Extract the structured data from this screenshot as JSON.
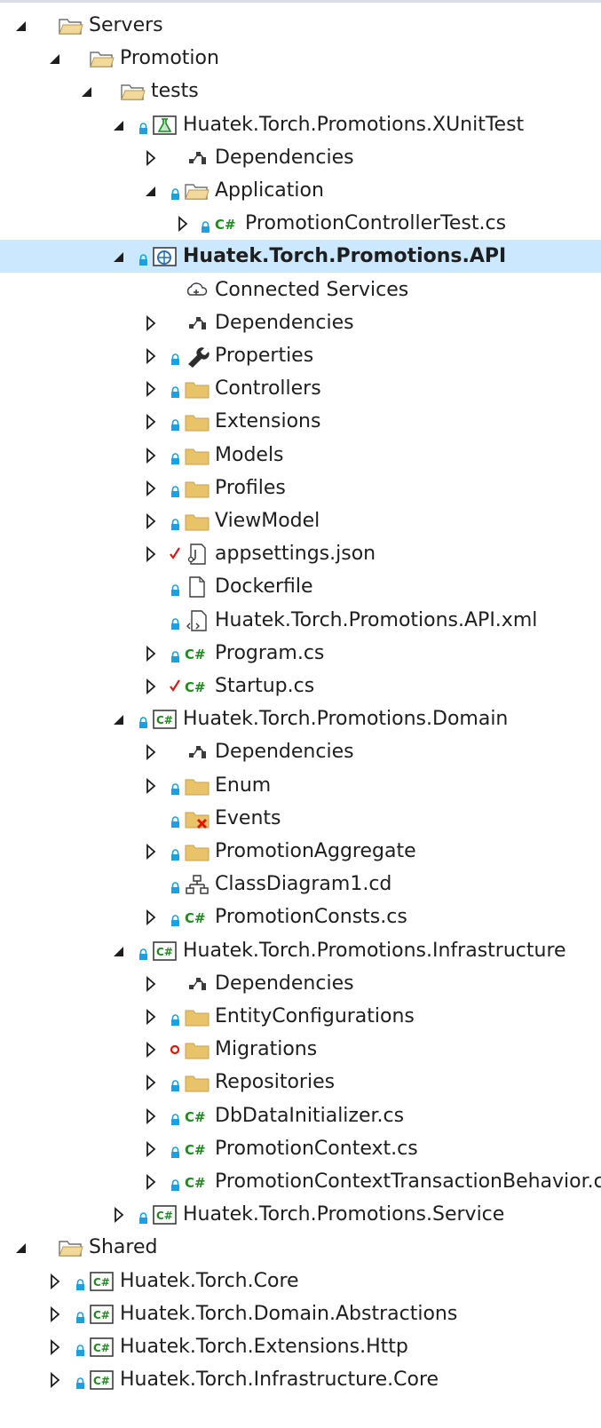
{
  "colors": {
    "folder": "#e8c36a",
    "folder_open": "#f2d99a",
    "selection": "#cce8ff",
    "lock": "#1ba1e2",
    "check": "#d11a1a",
    "csharp_green": "#1e8b1e",
    "csproj_blue": "#2a6fb0",
    "error_red": "#e51400"
  },
  "tree": [
    {
      "label": "Servers",
      "level": 0,
      "caret": "expanded",
      "icon": "folder-open-icon",
      "lock": false
    },
    {
      "label": "Promotion",
      "level": 1,
      "caret": "expanded",
      "icon": "folder-open-icon",
      "lock": false
    },
    {
      "label": "tests",
      "level": 2,
      "caret": "expanded",
      "icon": "folder-open-icon",
      "lock": false
    },
    {
      "label": "Huatek.Torch.Promotions.XUnitTest",
      "level": 3,
      "caret": "expanded",
      "icon": "test-project-icon",
      "lock": true
    },
    {
      "label": "Dependencies",
      "level": 4,
      "caret": "collapsed",
      "icon": "dependencies-icon",
      "lock": false
    },
    {
      "label": "Application",
      "level": 4,
      "caret": "expanded",
      "icon": "folder-open-icon",
      "lock": true
    },
    {
      "label": "PromotionControllerTest.cs",
      "level": 5,
      "caret": "collapsed",
      "icon": "csharp-file-icon",
      "lock": true
    },
    {
      "label": "Huatek.Torch.Promotions.API",
      "level": 3,
      "caret": "expanded",
      "icon": "web-project-icon",
      "lock": true,
      "selected": true
    },
    {
      "label": "Connected Services",
      "level": 4,
      "caret": "none",
      "icon": "connected-services-icon",
      "lock": false
    },
    {
      "label": "Dependencies",
      "level": 4,
      "caret": "collapsed",
      "icon": "dependencies-icon",
      "lock": false
    },
    {
      "label": "Properties",
      "level": 4,
      "caret": "collapsed",
      "icon": "wrench-icon",
      "lock": true
    },
    {
      "label": "Controllers",
      "level": 4,
      "caret": "collapsed",
      "icon": "folder-icon",
      "lock": true
    },
    {
      "label": "Extensions",
      "level": 4,
      "caret": "collapsed",
      "icon": "folder-icon",
      "lock": true
    },
    {
      "label": "Models",
      "level": 4,
      "caret": "collapsed",
      "icon": "folder-icon",
      "lock": true
    },
    {
      "label": "Profiles",
      "level": 4,
      "caret": "collapsed",
      "icon": "folder-icon",
      "lock": true
    },
    {
      "label": "ViewModel",
      "level": 4,
      "caret": "collapsed",
      "icon": "folder-icon",
      "lock": true
    },
    {
      "label": "appsettings.json",
      "level": 4,
      "caret": "collapsed",
      "icon": "json-file-icon",
      "lock": false,
      "status": "check"
    },
    {
      "label": "Dockerfile",
      "level": 4,
      "caret": "none",
      "icon": "file-icon",
      "lock": true
    },
    {
      "label": "Huatek.Torch.Promotions.API.xml",
      "level": 4,
      "caret": "none",
      "icon": "xml-file-icon",
      "lock": true
    },
    {
      "label": "Program.cs",
      "level": 4,
      "caret": "collapsed",
      "icon": "csharp-file-icon",
      "lock": true
    },
    {
      "label": "Startup.cs",
      "level": 4,
      "caret": "collapsed",
      "icon": "csharp-file-icon",
      "lock": false,
      "status": "check"
    },
    {
      "label": "Huatek.Torch.Promotions.Domain",
      "level": 3,
      "caret": "expanded",
      "icon": "csharp-project-icon",
      "lock": true
    },
    {
      "label": "Dependencies",
      "level": 4,
      "caret": "collapsed",
      "icon": "dependencies-icon",
      "lock": false
    },
    {
      "label": "Enum",
      "level": 4,
      "caret": "collapsed",
      "icon": "folder-icon",
      "lock": true
    },
    {
      "label": "Events",
      "level": 4,
      "caret": "none",
      "icon": "folder-error-icon",
      "lock": true
    },
    {
      "label": "PromotionAggregate",
      "level": 4,
      "caret": "collapsed",
      "icon": "folder-icon",
      "lock": true
    },
    {
      "label": "ClassDiagram1.cd",
      "level": 4,
      "caret": "none",
      "icon": "class-diagram-icon",
      "lock": true
    },
    {
      "label": "PromotionConsts.cs",
      "level": 4,
      "caret": "collapsed",
      "icon": "csharp-file-icon",
      "lock": true
    },
    {
      "label": "Huatek.Torch.Promotions.Infrastructure",
      "level": 3,
      "caret": "expanded",
      "icon": "csharp-project-icon",
      "lock": true
    },
    {
      "label": "Dependencies",
      "level": 4,
      "caret": "collapsed",
      "icon": "dependencies-icon",
      "lock": false
    },
    {
      "label": "EntityConfigurations",
      "level": 4,
      "caret": "collapsed",
      "icon": "folder-icon",
      "lock": true
    },
    {
      "label": "Migrations",
      "level": 4,
      "caret": "collapsed",
      "icon": "folder-icon",
      "lock": false,
      "status": "pending"
    },
    {
      "label": "Repositories",
      "level": 4,
      "caret": "collapsed",
      "icon": "folder-icon",
      "lock": true
    },
    {
      "label": "DbDataInitializer.cs",
      "level": 4,
      "caret": "collapsed",
      "icon": "csharp-file-icon",
      "lock": true
    },
    {
      "label": "PromotionContext.cs",
      "level": 4,
      "caret": "collapsed",
      "icon": "csharp-file-icon",
      "lock": true
    },
    {
      "label": "PromotionContextTransactionBehavior.cs",
      "level": 4,
      "caret": "collapsed",
      "icon": "csharp-file-icon",
      "lock": true
    },
    {
      "label": "Huatek.Torch.Promotions.Service",
      "level": 3,
      "caret": "collapsed",
      "icon": "csharp-project-icon",
      "lock": true
    },
    {
      "label": "Shared",
      "level": 0,
      "caret": "expanded",
      "icon": "folder-open-icon",
      "lock": false
    },
    {
      "label": "Huatek.Torch.Core",
      "level": 1,
      "caret": "collapsed",
      "icon": "csharp-project-icon",
      "lock": true
    },
    {
      "label": "Huatek.Torch.Domain.Abstractions",
      "level": 1,
      "caret": "collapsed",
      "icon": "csharp-project-icon",
      "lock": true
    },
    {
      "label": "Huatek.Torch.Extensions.Http",
      "level": 1,
      "caret": "collapsed",
      "icon": "csharp-project-icon",
      "lock": true
    },
    {
      "label": "Huatek.Torch.Infrastructure.Core",
      "level": 1,
      "caret": "collapsed",
      "icon": "csharp-project-icon",
      "lock": true
    }
  ]
}
